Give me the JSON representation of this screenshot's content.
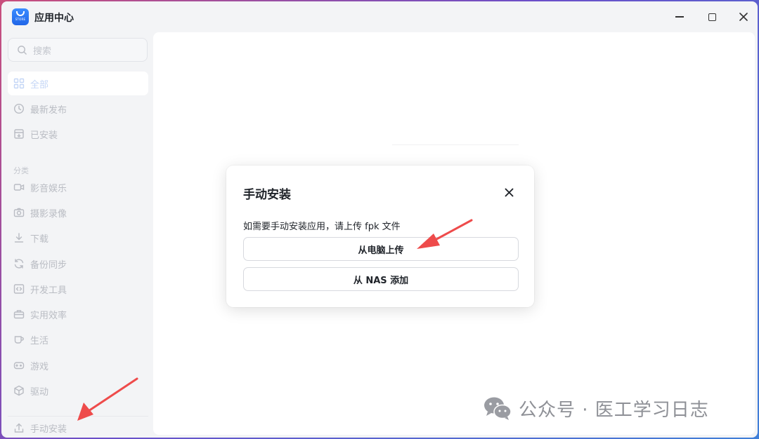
{
  "window": {
    "app_title": "应用中心",
    "icon_text": "STORE"
  },
  "sidebar": {
    "search_placeholder": "搜索",
    "top_items": [
      {
        "label": "全部",
        "icon": "grid-icon",
        "active": true
      },
      {
        "label": "最新发布",
        "icon": "clock-icon"
      },
      {
        "label": "已安装",
        "icon": "installed-box-icon"
      }
    ],
    "section_label": "分类",
    "categories": [
      {
        "label": "影音娱乐",
        "icon": "video-camera-icon"
      },
      {
        "label": "摄影录像",
        "icon": "camera-icon"
      },
      {
        "label": "下载",
        "icon": "download-icon"
      },
      {
        "label": "备份同步",
        "icon": "sync-icon"
      },
      {
        "label": "开发工具",
        "icon": "code-icon"
      },
      {
        "label": "实用效率",
        "icon": "toolbox-icon"
      },
      {
        "label": "生活",
        "icon": "cup-icon"
      },
      {
        "label": "游戏",
        "icon": "gamepad-icon"
      },
      {
        "label": "驱动",
        "icon": "cube-icon"
      }
    ],
    "bottom_item": {
      "label": "手动安装",
      "icon": "upload-icon"
    }
  },
  "dialog": {
    "title": "手动安装",
    "description": "如需要手动安装应用，请上传 fpk 文件",
    "button_pc": "从电脑上传",
    "button_nas": "从 NAS 添加"
  },
  "watermark": {
    "text": "公众号 · 医工学习日志"
  },
  "colors": {
    "annotation_arrow": "#ee4b4b",
    "sidebar_text": "#b9bcc3",
    "active_text": "#c4d6f6"
  }
}
